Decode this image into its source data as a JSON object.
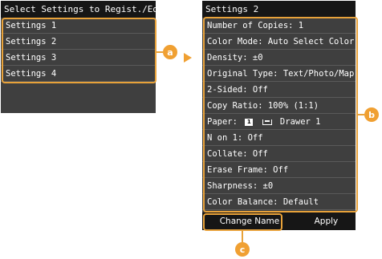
{
  "left_screen": {
    "title": "Select Settings to Regist./Edit",
    "items": [
      {
        "label": "Settings 1"
      },
      {
        "label": "Settings 2"
      },
      {
        "label": "Settings 3"
      },
      {
        "label": "Settings 4"
      }
    ]
  },
  "right_screen": {
    "title": "Settings 2",
    "items": [
      {
        "label": "Number of Copies: 1"
      },
      {
        "label": "Color Mode: Auto Select Color"
      },
      {
        "label": "Density: ±0"
      },
      {
        "label": "Original Type: Text/Photo/Map"
      },
      {
        "label": "2-Sided: Off"
      },
      {
        "label": "Copy Ratio: 100% (1:1)"
      },
      {
        "label_prefix": "Paper:",
        "icon_text": "1",
        "label_suffix": "Drawer 1"
      },
      {
        "label": "N on 1: Off"
      },
      {
        "label": "Collate: Off"
      },
      {
        "label": "Erase Frame: Off"
      },
      {
        "label": "Sharpness: ±0"
      },
      {
        "label": "Color Balance: Default"
      }
    ],
    "buttons": {
      "change_name": "Change Name",
      "apply": "Apply"
    }
  },
  "callouts": {
    "a": "a",
    "b": "b",
    "c": "c"
  },
  "colors": {
    "highlight": "#e8a23a",
    "screen_bg": "#3f3f3f",
    "bar_bg": "#161616"
  }
}
